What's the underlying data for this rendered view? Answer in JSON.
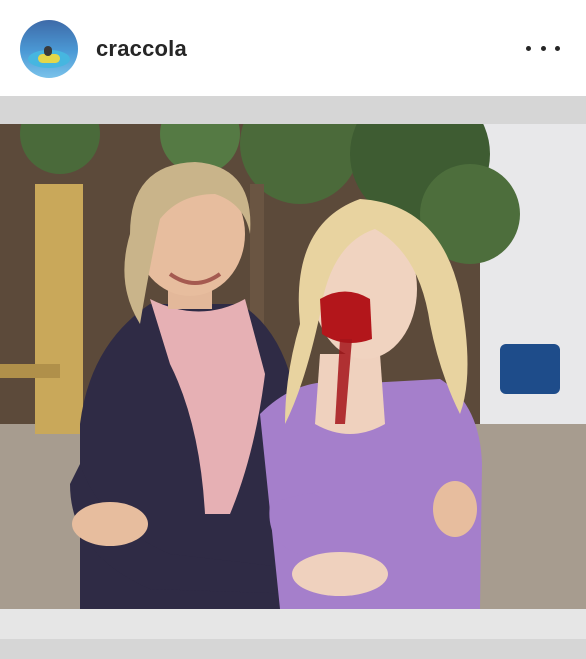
{
  "post": {
    "username": "craccola",
    "avatar_icon": "avatar-pool-icon",
    "more_icon": "more-options-icon"
  },
  "photo": {
    "content": "photo"
  },
  "colors": {
    "background": "#ffffff",
    "frame": "#d6d6d6",
    "text": "#262626"
  }
}
